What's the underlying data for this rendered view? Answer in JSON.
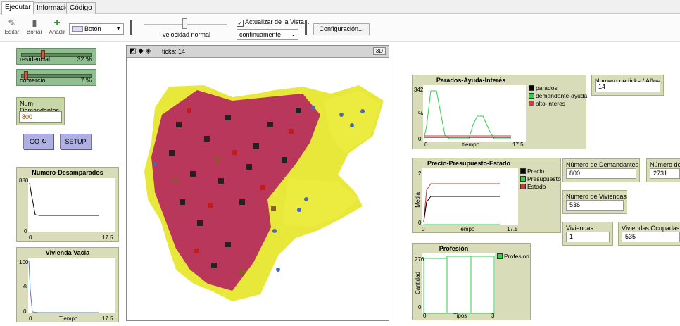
{
  "tabs": [
    "Ejecutar",
    "Información",
    "Código"
  ],
  "toolbar": {
    "edit": "Editar",
    "delete": "Borrar",
    "add": "Añadir",
    "widget_type": "Botón",
    "speed_label": "velocidad normal",
    "update_view": "Actualizar de la Vista...",
    "update_mode": "continuamente",
    "settings": "Configuración..."
  },
  "view": {
    "ticks_label": "ticks: 14",
    "mode3d": "3D"
  },
  "sliders": {
    "residencial": {
      "label": "residencial",
      "value": "32 %",
      "fraction": 0.32
    },
    "comercio": {
      "label": "comercio",
      "value": "7 %",
      "fraction": 0.07
    }
  },
  "num_demandantes_input": {
    "label": "Num-Demandantes",
    "value": "800"
  },
  "buttons": {
    "go": "GO",
    "setup": "SETUP"
  },
  "monitors": {
    "ticks_anos": {
      "label": "Numero de ticks / Años",
      "value": "14"
    },
    "num_demandantes": {
      "label": "Número de Demandantes",
      "value": "800"
    },
    "num_p": {
      "label": "Número de P",
      "value": "2731"
    },
    "num_viviendas": {
      "label": "Número de Viviendas",
      "value": "536"
    },
    "viviendas_vacias": {
      "label": "Viviendas Vacias",
      "value": "1"
    },
    "viviendas_ocupadas": {
      "label": "Viviendas Ocupadas",
      "value": "535"
    }
  },
  "colors": {
    "parados": "#000000",
    "demandante_ayuda": "#2bd14f",
    "alto_interes": "#d03a3a",
    "precio": "#000000",
    "presupuesto": "#2bd14f",
    "estado": "#c83a3a",
    "profesion": "#2bd14f",
    "desamparados": "#000000",
    "vacia": "#4a7be0"
  },
  "plots": {
    "desamparados": {
      "title": "Numero-Desamparados",
      "ymax": "880",
      "ymin": "0",
      "xmin": "0",
      "xmax": "17.5"
    },
    "vacia": {
      "title": "Vivienda Vacia",
      "ymax": "100",
      "ymin": "0",
      "xmin": "0",
      "xmax": "17.5",
      "ylabel": "%",
      "xlabel": "Tiempo"
    },
    "parados": {
      "title": "Parados-Ayuda-Interés",
      "ymax": "342",
      "ymin": "0",
      "xmin": "0",
      "xmax": "17.5",
      "ylabel": "%",
      "xlabel": "tiempo",
      "legend": [
        "parados",
        "demandante-ayuda",
        "alto-interes"
      ]
    },
    "precio": {
      "title": "Precio-Presupuesto-Estado",
      "ymax": "2",
      "ymin": "0",
      "xmin": "0",
      "xmax": "17.5",
      "ylabel": "Media",
      "xlabel": "Tiempo",
      "legend": [
        "Precio",
        "Presupuesto",
        "Estado"
      ]
    },
    "profesion": {
      "title": "Profesión",
      "ymax": "276",
      "ymin": "0",
      "xmin": "0",
      "xmax": "3",
      "ylabel": "Cantidad",
      "xlabel": "Tipos",
      "legend": [
        "Profesion"
      ]
    }
  }
}
